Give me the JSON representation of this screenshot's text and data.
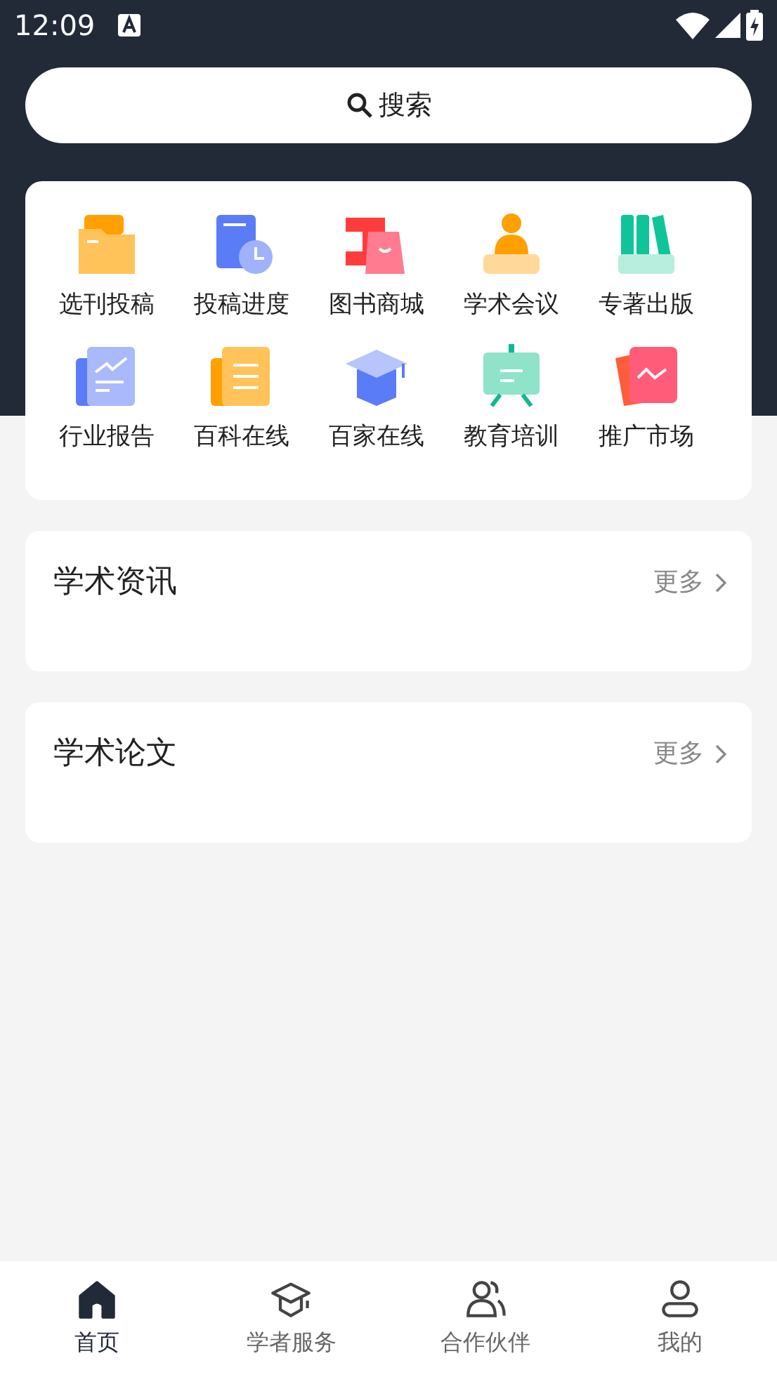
{
  "status_bar": {
    "time": "12:09"
  },
  "search": {
    "placeholder": "搜索"
  },
  "grid": [
    {
      "label": "选刊投稿"
    },
    {
      "label": "投稿进度"
    },
    {
      "label": "图书商城"
    },
    {
      "label": "学术会议"
    },
    {
      "label": "专著出版"
    },
    {
      "label": "行业报告"
    },
    {
      "label": "百科在线"
    },
    {
      "label": "百家在线"
    },
    {
      "label": "教育培训"
    },
    {
      "label": "推广市场"
    }
  ],
  "sections": [
    {
      "title": "学术资讯",
      "more": "更多"
    },
    {
      "title": "学术论文",
      "more": "更多"
    }
  ],
  "bottom_nav": [
    {
      "label": "首页",
      "selected": true
    },
    {
      "label": "学者服务",
      "selected": false
    },
    {
      "label": "合作伙伴",
      "selected": false
    },
    {
      "label": "我的",
      "selected": false
    }
  ]
}
